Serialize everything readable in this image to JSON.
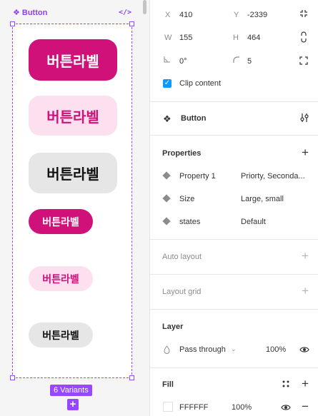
{
  "canvas": {
    "component_title": "Button",
    "code_icon": "code-icon",
    "variants": [
      {
        "label": "버튼라벨",
        "style": "primary-large",
        "bg": "#d0117a",
        "fg": "#ffffff"
      },
      {
        "label": "버튼라벨",
        "style": "secondary-large",
        "bg": "#fde0ef",
        "fg": "#d0117a"
      },
      {
        "label": "버튼라벨",
        "style": "default-large",
        "bg": "#e6e6e6",
        "fg": "#111111"
      },
      {
        "label": "버튼라벨",
        "style": "primary-small",
        "bg": "#d0117a",
        "fg": "#ffffff"
      },
      {
        "label": "버튼라벨",
        "style": "secondary-small",
        "bg": "#fde0ef",
        "fg": "#d0117a"
      },
      {
        "label": "버튼라벨",
        "style": "default-small",
        "bg": "#e6e6e6",
        "fg": "#111111"
      }
    ],
    "variants_badge": "6 Variants",
    "selection_color": "#9747ff"
  },
  "panel": {
    "geometry": {
      "x_label": "X",
      "x_value": "410",
      "y_label": "Y",
      "y_value": "-2339",
      "w_label": "W",
      "w_value": "155",
      "h_label": "H",
      "h_value": "464",
      "rotation_value": "0°",
      "radius_value": "5",
      "clip_content_label": "Clip content",
      "clip_content_checked": true
    },
    "component": {
      "name": "Button"
    },
    "properties": {
      "title": "Properties",
      "items": [
        {
          "name": "Property 1",
          "value": "Priorty, Seconda..."
        },
        {
          "name": "Size",
          "value": "Large, small"
        },
        {
          "name": "states",
          "value": "Default"
        }
      ]
    },
    "auto_layout": {
      "title": "Auto layout"
    },
    "layout_grid": {
      "title": "Layout grid"
    },
    "layer": {
      "title": "Layer",
      "blend_mode": "Pass through",
      "opacity": "100%"
    },
    "fill": {
      "title": "Fill",
      "hex": "FFFFFF",
      "opacity": "100%",
      "swatch_color": "#ffffff"
    },
    "accent_color": "#0d99ff"
  }
}
